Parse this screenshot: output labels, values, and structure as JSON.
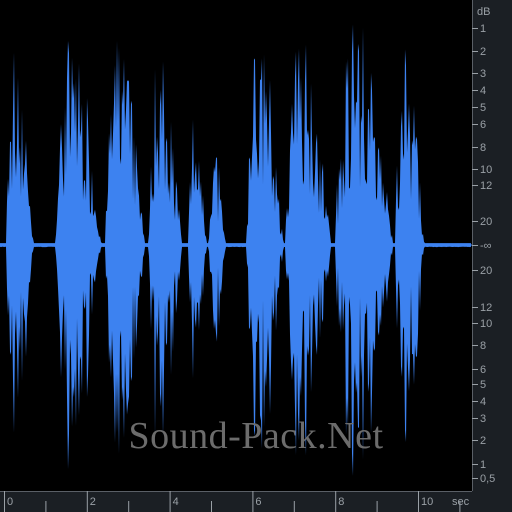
{
  "db_scale": {
    "unit": "dB",
    "labels": [
      "1",
      "2",
      "3",
      "4",
      "5",
      "6",
      "8",
      "10",
      "12",
      "20",
      "-∞",
      "20",
      "12",
      "10",
      "8",
      "6",
      "5",
      "4",
      "3",
      "2",
      "1",
      "0,5"
    ],
    "positive_db": [
      1,
      2,
      3,
      4,
      5,
      6,
      8,
      10,
      12,
      20
    ],
    "negative_db": [
      20,
      12,
      10,
      8,
      6,
      5,
      4,
      3,
      2,
      1,
      0.5
    ]
  },
  "time_ruler": {
    "unit": "sec",
    "labels": [
      "0",
      "2",
      "4",
      "6",
      "8",
      "10"
    ],
    "max_seconds": 11.3
  },
  "waveform": {
    "color": "#3d82f0",
    "bursts": [
      {
        "start": 0.05,
        "end": 0.72,
        "peak": 0.78
      },
      {
        "start": 1.25,
        "end": 2.35,
        "peak": 0.86
      },
      {
        "start": 2.45,
        "end": 3.4,
        "peak": 0.9
      },
      {
        "start": 3.5,
        "end": 4.3,
        "peak": 0.82
      },
      {
        "start": 4.45,
        "end": 4.9,
        "peak": 0.55
      },
      {
        "start": 4.95,
        "end": 5.35,
        "peak": 0.4
      },
      {
        "start": 5.85,
        "end": 6.75,
        "peak": 0.85
      },
      {
        "start": 6.8,
        "end": 7.9,
        "peak": 0.92
      },
      {
        "start": 8.0,
        "end": 9.4,
        "peak": 0.95
      },
      {
        "start": 9.45,
        "end": 10.15,
        "peak": 0.86
      }
    ]
  },
  "watermark": "Sound-Pack.Net",
  "colors": {
    "background": "#000000",
    "ruler": "#1b1f24",
    "ruler_text": "#9aa0a6",
    "watermark": "#6c6c6c"
  }
}
